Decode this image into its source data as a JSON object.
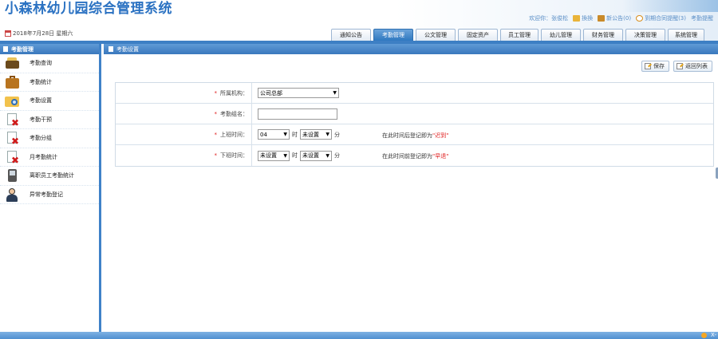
{
  "app": {
    "title": "小森林幼儿园综合管理系统",
    "date": "2018年7月28日 星期六"
  },
  "userbar": {
    "welcome": "欢迎你：",
    "username": "张俊松",
    "switch": "換換",
    "new_docs": "新公告(0)",
    "contract_reminder": "到期合同提醒(3)",
    "attendance_reminder": "考勤提醒"
  },
  "tabs": [
    {
      "label": "通知公告",
      "active": false
    },
    {
      "label": "考勤管理",
      "active": true
    },
    {
      "label": "公文管理",
      "active": false
    },
    {
      "label": "固定资产",
      "active": false
    },
    {
      "label": "员工管理",
      "active": false
    },
    {
      "label": "幼儿管理",
      "active": false
    },
    {
      "label": "财务管理",
      "active": false
    },
    {
      "label": "决策管理",
      "active": false
    },
    {
      "label": "系统管理",
      "active": false
    }
  ],
  "sidebar": {
    "header": "考勤管理",
    "items": [
      {
        "label": "考勤查询",
        "icon": "cashbox-icon"
      },
      {
        "label": "考勤统计",
        "icon": "briefcase-icon"
      },
      {
        "label": "考勤设置",
        "icon": "folder-search-icon"
      },
      {
        "label": "考勤干预",
        "icon": "document-delete-icon"
      },
      {
        "label": "考勤分组",
        "icon": "document-delete-icon"
      },
      {
        "label": "月考勤统计",
        "icon": "document-delete-icon"
      },
      {
        "label": "离职员工考勤统计",
        "icon": "pda-icon"
      },
      {
        "label": "异常考勤登记",
        "icon": "person-icon"
      }
    ]
  },
  "main": {
    "header": "考勤设置",
    "toolbar": {
      "save": "保存",
      "back": "返回列表"
    },
    "form": {
      "org": {
        "label": "所属机构：",
        "value": "公司总部"
      },
      "group_name": {
        "label": "考勤组名：",
        "value": ""
      },
      "on_duty": {
        "label": "上班时间：",
        "hour": "04",
        "hour_unit": "时",
        "minute": "未设置",
        "minute_unit": "分",
        "hint_prefix": "在此时间后登记即为",
        "hint_emph": "\"迟到\""
      },
      "off_duty": {
        "label": "下班时间：",
        "hour": "未设置",
        "hour_unit": "时",
        "minute": "未设置",
        "minute_unit": "分",
        "hint_prefix": "在此时间前登记即为",
        "hint_emph": "\"早退\""
      },
      "required_mark": "*"
    }
  },
  "bottombar": {
    "label": "X-"
  },
  "colors": {
    "brand": "#2b72c2",
    "accent": "#3d7fc4",
    "required": "#e02020"
  }
}
